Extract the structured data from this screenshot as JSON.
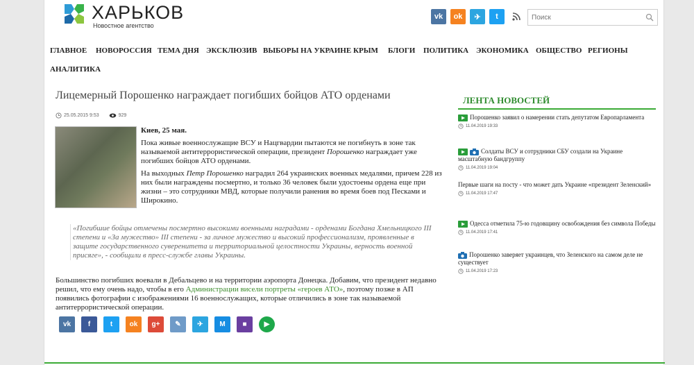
{
  "brand": {
    "title": "ХАРЬКОВ",
    "subtitle": "Новостное агентство"
  },
  "search": {
    "placeholder": "Поиск"
  },
  "social_top": [
    {
      "icon": "vk-icon",
      "glyph": "vk",
      "color": "#4c75a3"
    },
    {
      "icon": "odnoklassniki-icon",
      "glyph": "ok",
      "color": "#f58220"
    },
    {
      "icon": "telegram-icon",
      "glyph": "✈",
      "color": "#2ca5e0"
    },
    {
      "icon": "twitter-icon",
      "glyph": "t",
      "color": "#1da1f2"
    }
  ],
  "nav": [
    "ГЛАВНОЕ",
    "НОВОРОССИЯ",
    "ТЕМА ДНЯ",
    "ЭКСКЛЮЗИВ",
    "ВЫБОРЫ НА УКРАИНЕ",
    "КРЫМ",
    "БЛОГИ",
    "ПОЛИТИКА",
    "ЭКОНОМИКА",
    "ОБЩЕСТВО",
    "РЕГИОНЫ",
    "АНАЛИТИКА"
  ],
  "article": {
    "title": "Лицемерный Порошенко награждает погибших бойцов АТО орденами",
    "date": "25.05.2015 9:53",
    "views": "929",
    "lead": "Киев, 25 мая.",
    "p1_a": "Пока живые военнослужащие ВСУ и Нацгвардии пытаются не погибнуть в зоне так называемой антитеррористической операции, президент ",
    "p1_em": "Порошенко",
    "p1_b": " награждает уже погибших бойцов АТО орденами.",
    "p2_a": "На выходных ",
    "p2_em": "Петр Порошенко",
    "p2_b": " наградил 264 украинских военных медалями, причем 228 из них были награждены посмертно, и только 36 человек были удостоены ордена еще при жизни – это сотрудники МВД, которые получили ранения во время боев под Песками и Широкино.",
    "quote": "«Погибшие бойцы отмечены посмертно высокими военными наградами - орденами Богдана Хмельницкого III степени и «За мужество» III степени - за личное мужество и высокий профессионализм, проявленные в защите государственного суверенитета и территориальной целостности Украины, верность военной присяге», - сообщили в пресс-службе главы Украины.",
    "after_a": "Большинство погибших воевали в Дебальцево и на территории аэропорта Донецка. Добавим, что президент недавно решил, что ему очень надо, чтобы в его ",
    "after_link": "Администрации висели портреты «героев АТО»",
    "after_b": ", поэтому позже в АП появились фотографии с изображениями 16 военнослужащих, которые отличились в зоне так называемой антитеррористической операции."
  },
  "share": [
    {
      "icon": "vk-icon",
      "glyph": "vk",
      "color": "#4c75a3"
    },
    {
      "icon": "facebook-icon",
      "glyph": "f",
      "color": "#3b5998"
    },
    {
      "icon": "twitter-icon",
      "glyph": "t",
      "color": "#1da1f2"
    },
    {
      "icon": "odnoklassniki-icon",
      "glyph": "ok",
      "color": "#f58220"
    },
    {
      "icon": "google-plus-icon",
      "glyph": "g+",
      "color": "#dd4b39"
    },
    {
      "icon": "livejournal-icon",
      "glyph": "✎",
      "color": "#6f9bc8"
    },
    {
      "icon": "telegram-icon",
      "glyph": "✈",
      "color": "#2ca5e0"
    },
    {
      "icon": "moimir-icon",
      "glyph": "M",
      "color": "#168de2"
    },
    {
      "icon": "bookmark-icon",
      "glyph": "■",
      "color": "#6a3fa0"
    },
    {
      "icon": "play-icon",
      "glyph": "▶",
      "color": "#1ea84a"
    }
  ],
  "feed": {
    "title": "ЛЕНТА НОВОСТЕЙ",
    "items": [
      {
        "icon": "video",
        "text": "Порошенко заявил о намерении стать депутатом Европарламента",
        "date": "11.04.2019 19:33"
      },
      {
        "icon": "video-photo",
        "text": "Солдаты ВСУ и сотрудники СБУ создали на Украине масштабную бандгруппу",
        "date": "11.04.2019 19:04"
      },
      {
        "icon": "none",
        "text": "Первые шаги на посту - что может дать Украине «президент Зеленский»",
        "date": "11.04.2019 17:47"
      },
      {
        "icon": "video",
        "text": "Одесса отметила 75-ю годовщину освобождения без символа Победы",
        "date": "11.04.2019 17:41"
      },
      {
        "icon": "photo",
        "text": "Порошенко заверяет украинцев, что Зеленского на самом деле не существует",
        "date": "11.04.2019 17:23"
      }
    ]
  },
  "colors": {
    "accent": "#3aaa35",
    "feed_title": "#2e8b2e"
  }
}
